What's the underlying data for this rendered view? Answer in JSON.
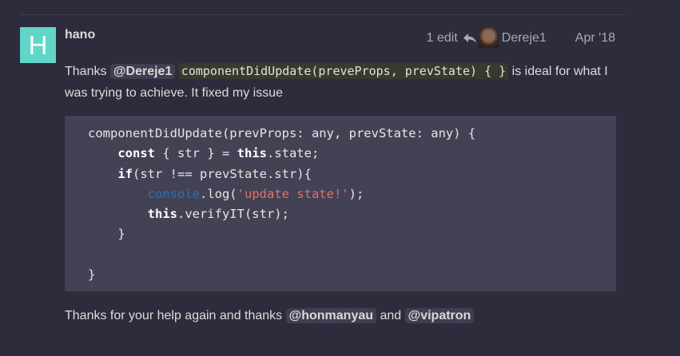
{
  "post": {
    "author_initial": "H",
    "username": "hano",
    "edits": "1 edit",
    "editor": "Dereje1",
    "date": "Apr '18",
    "text_1": "Thanks ",
    "mention_1": "@Dereje1",
    "inline_code": "componentDidUpdate(preveProps, prevState) { }",
    "text_2": " is ideal for what I was trying to achieve. It fixed my issue",
    "code": {
      "line1": "componentDidUpdate(prevProps: any, prevState: any) {",
      "line2_kw": "const",
      "line2_rest": " { str } = ",
      "line2_this": "this",
      "line2_end": ".state;",
      "line3_kw": "if",
      "line3_rest": "(str !== prevState.str){",
      "line4_console": "console",
      "line4_mid": ".log(",
      "line4_str": "'update state!'",
      "line4_end": ");",
      "line5_this": "this",
      "line5_rest": ".verifyIT(str);",
      "line6": "}",
      "line8": "}"
    },
    "footer_1": "Thanks for your help again and thanks ",
    "mention_2": "@honmanyau",
    "footer_and": " and ",
    "mention_3": "@vipatron"
  },
  "colors": {
    "background": "#2d2c3c",
    "avatar": "#5fd6c7",
    "code_bg": "#434254",
    "mention_bg": "#403f52"
  },
  "icons": [
    "reply-icon"
  ]
}
